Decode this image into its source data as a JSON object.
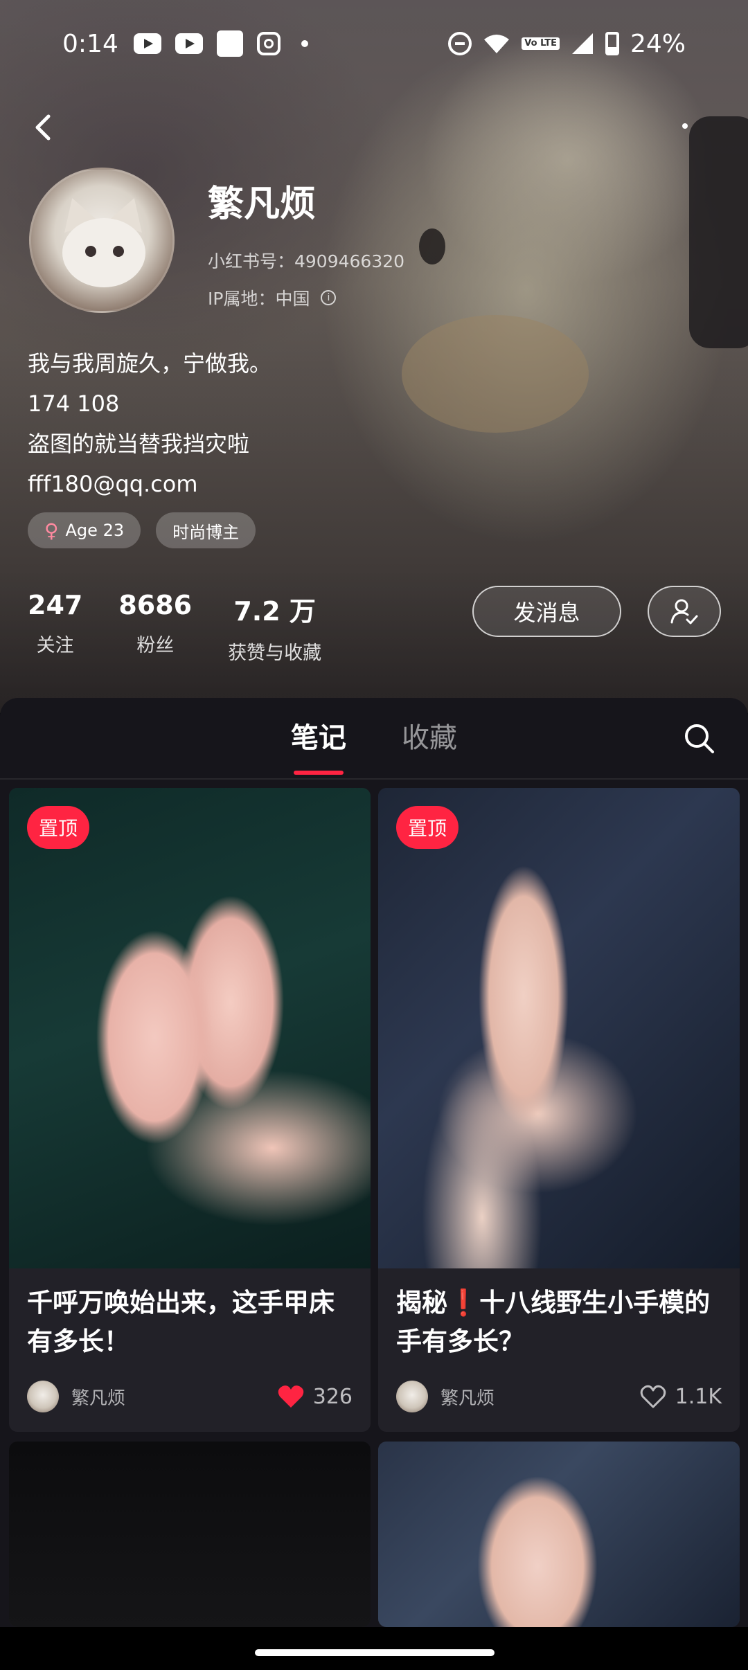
{
  "status_bar": {
    "time": "0:14",
    "battery": "24%",
    "volte": "Vo LTE"
  },
  "profile": {
    "username": "繁凡烦",
    "red_id": "小红书号：4909466320",
    "ip_location": "IP属地：中国",
    "bio_lines": [
      "我与我周旋久，宁做我。",
      "174 108",
      "盗图的就当替我挡灾啦",
      "fff180@qq.com"
    ],
    "tags": [
      {
        "icon": "female-icon",
        "label": "Age 23"
      },
      {
        "label": "时尚博主"
      }
    ],
    "stats": [
      {
        "value": "247",
        "label": "关注"
      },
      {
        "value": "8686",
        "label": "粉丝"
      },
      {
        "value": "7.2 万",
        "label": "获赞与收藏"
      }
    ],
    "message_button": "发消息"
  },
  "tabs": {
    "notes": "笔记",
    "favorites": "收藏",
    "active": "笔记"
  },
  "posts": [
    {
      "pinned_label": "置顶",
      "title": "千呼万唤始出来，这手甲床有多长！",
      "author": "繁凡烦",
      "likes": "326",
      "liked": true
    },
    {
      "pinned_label": "置顶",
      "title": "揭秘❗十八线野生小手模的手有多长？",
      "author": "繁凡烦",
      "likes": "1.1K",
      "liked": false
    }
  ],
  "colors": {
    "accent": "#ff2442",
    "panel": "#16151b",
    "card": "#222128"
  }
}
